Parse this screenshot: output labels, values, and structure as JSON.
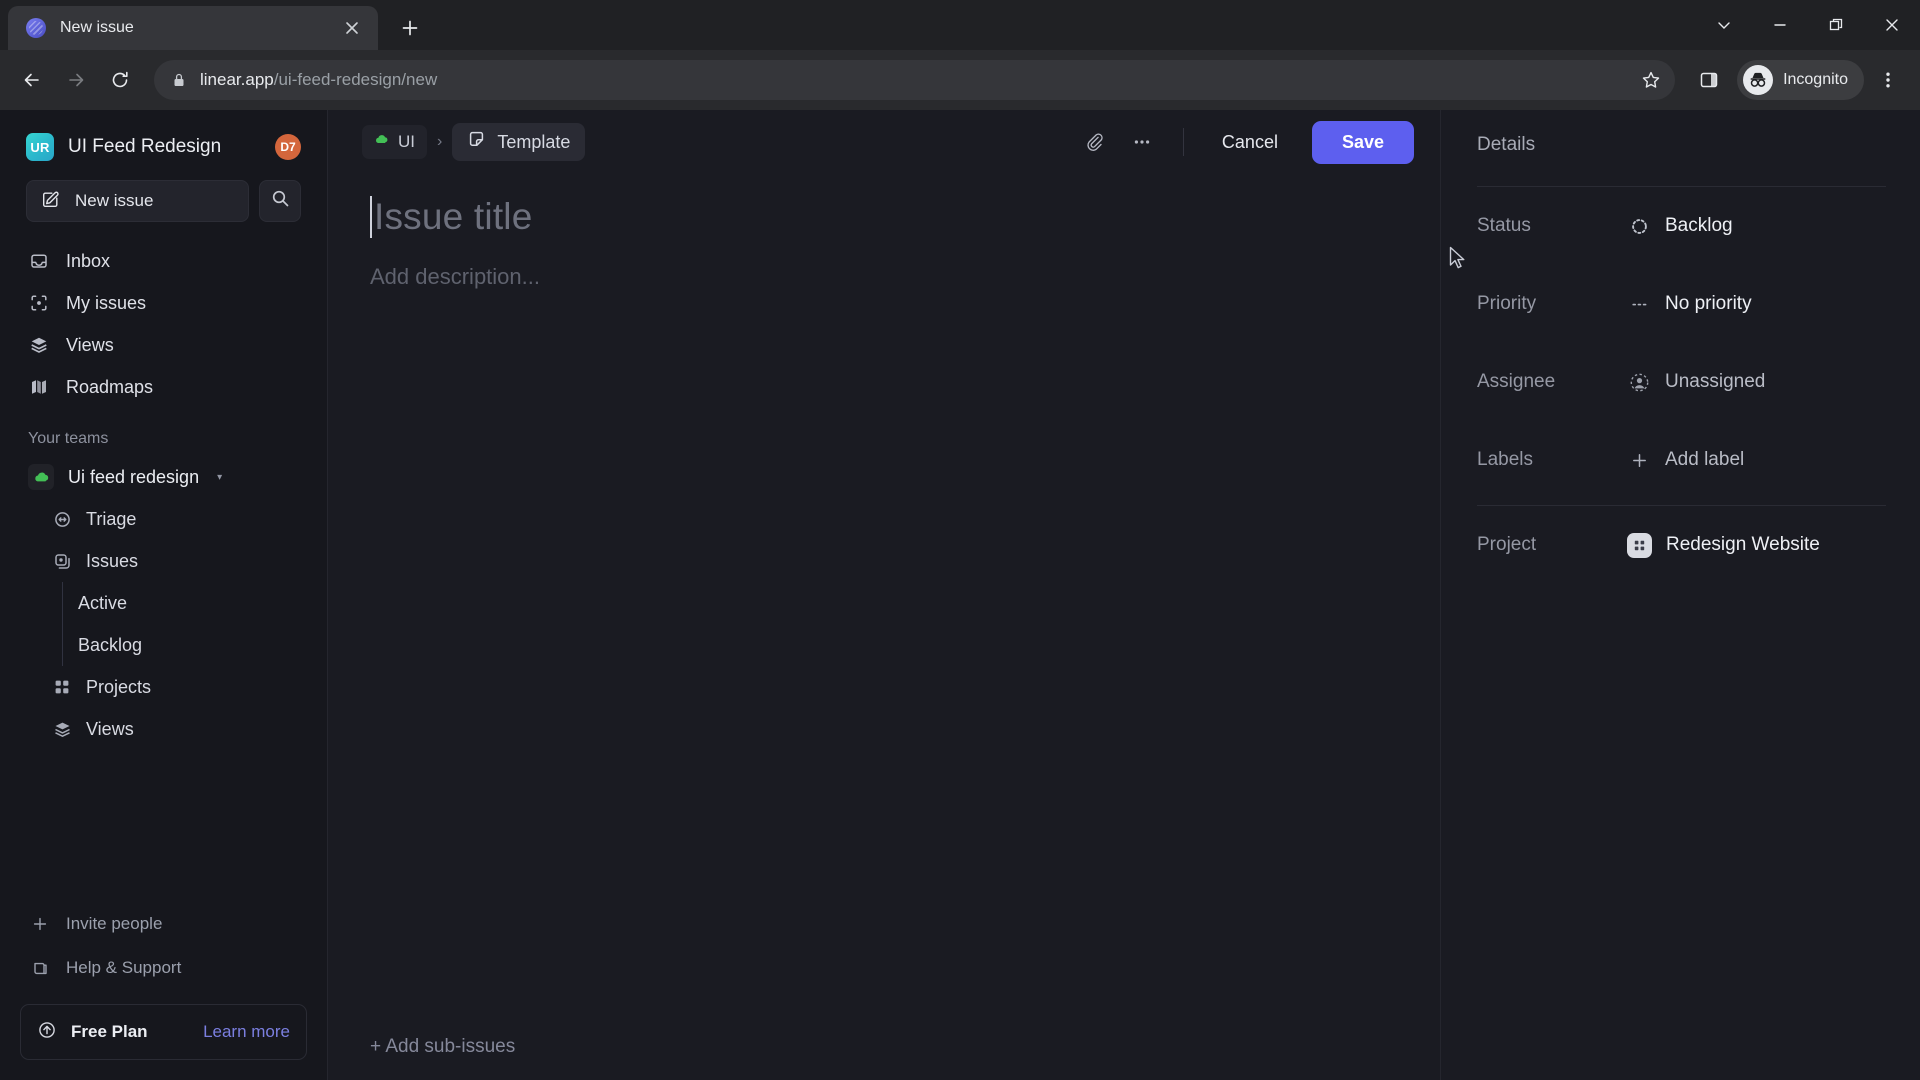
{
  "browser": {
    "tab": {
      "title": "New issue",
      "favicon": "linear-logo-icon",
      "close": "×"
    },
    "new_tab_label": "+",
    "window_controls": [
      {
        "name": "chevron-down-icon"
      },
      {
        "name": "minimize-icon"
      },
      {
        "name": "restore-icon"
      },
      {
        "name": "close-icon"
      }
    ],
    "nav": {
      "back": "back-arrow-icon",
      "forward": "forward-arrow-icon",
      "reload": "reload-icon"
    },
    "address": {
      "domain": "linear.app",
      "path": "/ui-feed-redesign/new",
      "lock": "lock-icon"
    },
    "profile": {
      "label": "Incognito",
      "icon": "incognito-icon"
    },
    "star": "bookmark-star-icon",
    "side_panel": "side-panel-icon",
    "menu": "three-dot-menu-icon"
  },
  "sidebar": {
    "workspace": {
      "initials": "UR",
      "name": "UI Feed Redesign",
      "badge": "D7"
    },
    "new_issue": {
      "label": "New issue",
      "icon": "compose-icon"
    },
    "search": {
      "icon": "search-icon"
    },
    "nav": [
      {
        "label": "Inbox",
        "icon": "inbox-icon"
      },
      {
        "label": "My issues",
        "icon": "my-issues-icon"
      },
      {
        "label": "Views",
        "icon": "layers-icon"
      },
      {
        "label": "Roadmaps",
        "icon": "roadmap-icon"
      }
    ],
    "teams_heading": "Your teams",
    "team": {
      "name": "Ui feed redesign",
      "icon": "green-cloud-icon",
      "caret": "▾"
    },
    "team_items": [
      {
        "label": "Triage",
        "icon": "triage-icon"
      },
      {
        "label": "Issues",
        "icon": "issues-icon"
      }
    ],
    "issue_children": [
      {
        "label": "Active"
      },
      {
        "label": "Backlog"
      }
    ],
    "team_items_tail": [
      {
        "label": "Projects",
        "icon": "projects-grid-icon"
      },
      {
        "label": "Views",
        "icon": "layers-icon"
      }
    ],
    "footer": [
      {
        "label": "Invite people",
        "icon": "plus-icon"
      },
      {
        "label": "Help & Support",
        "icon": "book-icon"
      }
    ],
    "plan": {
      "name": "Free Plan",
      "link": "Learn more",
      "icon": "upgrade-arrow-icon"
    }
  },
  "main": {
    "breadcrumb": {
      "team": "UI",
      "team_icon": "green-cloud-icon",
      "separator": "›",
      "template": "Template",
      "template_icon": "template-icon"
    },
    "actions": {
      "attach": "paperclip-icon",
      "more": "three-dot-icon",
      "cancel": "Cancel",
      "save": "Save"
    },
    "editor": {
      "title_placeholder": "Issue title",
      "description_placeholder": "Add description...",
      "add_sub_issues": "+ Add sub-issues"
    }
  },
  "details": {
    "heading": "Details",
    "rows": [
      {
        "label": "Status",
        "value": "Backlog",
        "icon": "backlog-dotted-circle-icon"
      },
      {
        "label": "Priority",
        "value": "No priority",
        "icon": "no-priority-dashes-icon"
      },
      {
        "label": "Assignee",
        "value": "Unassigned",
        "icon": "user-circle-icon"
      },
      {
        "label": "Labels",
        "value": "Add label",
        "icon": "plus-icon"
      }
    ],
    "project": {
      "label": "Project",
      "value": "Redesign Website",
      "icon": "project-grid-icon"
    }
  },
  "colors": {
    "accent": "#5d5fef",
    "link": "#7b7fe0",
    "badge": "#d4663c",
    "workspace_avatar": "#2bb8cc",
    "team_icon": "#43c056",
    "app_bg": "#1a1b22",
    "sidebar_bg": "#16171d"
  }
}
